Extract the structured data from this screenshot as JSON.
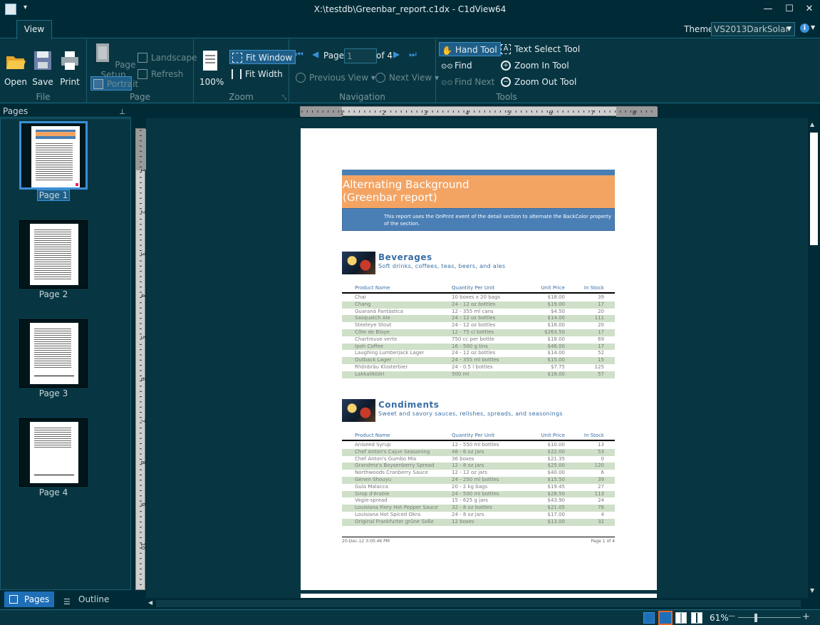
{
  "window": {
    "title": "X:\\testdb\\Greenbar_report.c1dx - C1dView64",
    "minimize_glyph": "—",
    "maximize_glyph": "☐",
    "close_glyph": "✕",
    "qa_glyph": "▾"
  },
  "ribbon": {
    "tab": "View",
    "theme_label": "Theme:",
    "theme_value": "VS2013DarkSolar",
    "help_glyph": "i",
    "groups": {
      "file": {
        "label": "File",
        "open": "Open",
        "save": "Save",
        "print": "Print"
      },
      "page": {
        "label": "Page",
        "page_setup": "Page Setup",
        "portrait": "Portrait",
        "landscape": "Landscape",
        "refresh": "Refresh"
      },
      "zoom": {
        "label": "Zoom",
        "percent": "100%",
        "fit_window": "Fit Window",
        "fit_width": "Fit Width"
      },
      "navigation": {
        "label": "Navigation",
        "page_word": "Page",
        "page_value": "1",
        "of_total": "of 4",
        "previous_view": "Previous View",
        "next_view": "Next View"
      },
      "tools": {
        "label": "Tools",
        "hand_tool": "Hand Tool",
        "find": "Find",
        "find_next": "Find Next",
        "text_select_tool": "Text Select Tool",
        "zoom_in_tool": "Zoom In Tool",
        "zoom_out_tool": "Zoom Out Tool"
      }
    }
  },
  "pages_panel": {
    "title": "Pages",
    "pin_glyph": "⊥",
    "thumbnails": [
      "Page 1",
      "Page 2",
      "Page 3",
      "Page 4"
    ],
    "selected": "Page 1",
    "tabs": {
      "pages": "Pages",
      "outline": "Outline"
    }
  },
  "report": {
    "title_line1": "Alternating Background",
    "title_line2": "(Greenbar report)",
    "subtitle": "This report uses the OnPrint event of the detail section to alternate the BackColor property of the section.",
    "columns": [
      "Product Name",
      "Quantity Per Unit",
      "Unit Price",
      "In Stock"
    ],
    "categories": [
      {
        "name": "Beverages",
        "description": "Soft drinks, coffees, teas, beers, and ales",
        "rows": [
          [
            "Chai",
            "10 boxes x 20 bags",
            "$18.00",
            "39"
          ],
          [
            "Chang",
            "24 - 12 oz bottles",
            "$19.00",
            "17"
          ],
          [
            "Guaraná Fantástica",
            "12 - 355 ml cans",
            "$4.50",
            "20"
          ],
          [
            "Sasquatch Ale",
            "24 - 12 oz bottles",
            "$14.00",
            "111"
          ],
          [
            "Steeleye Stout",
            "24 - 12 oz bottles",
            "$18.00",
            "20"
          ],
          [
            "Côte de Blaye",
            "12 - 75 cl bottles",
            "$263.50",
            "17"
          ],
          [
            "Chartreuse verte",
            "750 cc per bottle",
            "$18.00",
            "69"
          ],
          [
            "Ipoh Coffee",
            "16 - 500 g tins",
            "$46.00",
            "17"
          ],
          [
            "Laughing Lumberjack Lager",
            "24 - 12 oz bottles",
            "$14.00",
            "52"
          ],
          [
            "Outback Lager",
            "24 - 355 ml bottles",
            "$15.00",
            "15"
          ],
          [
            "Rhönbräu Klosterbier",
            "24 - 0.5 l bottles",
            "$7.75",
            "125"
          ],
          [
            "Lakkalikööri",
            "500 ml",
            "$18.00",
            "57"
          ]
        ]
      },
      {
        "name": "Condiments",
        "description": "Sweet and savory sauces, relishes, spreads, and seasonings",
        "rows": [
          [
            "Aniseed Syrup",
            "12 - 550 ml bottles",
            "$10.00",
            "13"
          ],
          [
            "Chef Anton's Cajun Seasoning",
            "48 - 6 oz jars",
            "$22.00",
            "53"
          ],
          [
            "Chef Anton's Gumbo Mix",
            "36 boxes",
            "$21.35",
            "0"
          ],
          [
            "Grandma's Boysenberry Spread",
            "12 - 8 oz jars",
            "$25.00",
            "120"
          ],
          [
            "Northwoods Cranberry Sauce",
            "12 - 12 oz jars",
            "$40.00",
            "6"
          ],
          [
            "Genen Shouyu",
            "24 - 250 ml bottles",
            "$15.50",
            "39"
          ],
          [
            "Gula Malacca",
            "20 - 2 kg bags",
            "$19.45",
            "27"
          ],
          [
            "Sirop d'érable",
            "24 - 500 ml bottles",
            "$28.50",
            "113"
          ],
          [
            "Vegie-spread",
            "15 - 625 g jars",
            "$43.90",
            "24"
          ],
          [
            "Louisiana Fiery Hot Pepper Sauce",
            "32 - 8 oz bottles",
            "$21.05",
            "76"
          ],
          [
            "Louisiana Hot Spiced Okra",
            "24 - 8 oz jars",
            "$17.00",
            "4"
          ],
          [
            "Original Frankfurter grüne Soße",
            "12 boxes",
            "$13.00",
            "32"
          ]
        ]
      }
    ],
    "footer_left": "20-Dec-12 3:00:46 PM",
    "footer_right": "Page 1 of 4"
  },
  "rulers": {
    "horizontal_ticks": [
      "1",
      "2",
      "3",
      "4",
      "5",
      "6",
      "7",
      "8"
    ],
    "vertical_ticks": [
      "1",
      "2",
      "3",
      "4",
      "5",
      "6",
      "7",
      "8",
      "9",
      "10"
    ]
  },
  "statusbar": {
    "zoom": "61%",
    "zoom_minus": "—",
    "zoom_plus": "+"
  },
  "colors": {
    "background": "#002b36",
    "panel": "#073642",
    "accent": "#1e6fb8",
    "banner_orange": "#f3a463",
    "banner_blue": "#4a7fb5",
    "greenbar": "#cfe0c9"
  }
}
